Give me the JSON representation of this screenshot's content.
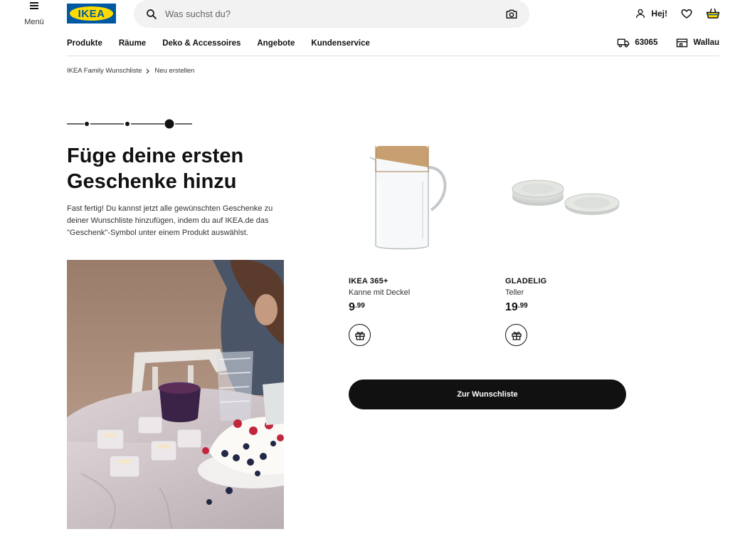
{
  "header": {
    "menu_label": "Menü",
    "logo_text": "IKEA",
    "search_placeholder": "Was suchst du?",
    "greeting": "Hej!"
  },
  "nav": {
    "items": [
      "Produkte",
      "Räume",
      "Deko & Accessoires",
      "Angebote",
      "Kundenservice"
    ],
    "postcode": "63065",
    "store": "Wallau"
  },
  "breadcrumb": {
    "parent": "IKEA Family Wunschliste",
    "current": "Neu erstellen"
  },
  "stepper": {
    "steps": 3,
    "active_step": 3
  },
  "main": {
    "title": "Füge deine ersten Geschenke hinzu",
    "description": "Fast fertig! Du kannst jetzt alle gewünschten Geschenke zu deiner Wunschliste hinzufügen, indem du auf IKEA.de das \"Geschenk\"-Symbol unter einem Produkt auswählst."
  },
  "products": [
    {
      "name": "IKEA 365+",
      "description": "Kanne mit Deckel",
      "price_int": "9",
      "price_dec": ".99",
      "icon": "gift-icon"
    },
    {
      "name": "GLADELIG",
      "description": "Teller",
      "price_int": "19",
      "price_dec": ".99",
      "icon": "gift-icon"
    }
  ],
  "cta_label": "Zur Wunschliste",
  "colors": {
    "ikea_blue": "#0058a3",
    "ikea_yellow": "#ffdb00",
    "cta_bg": "#111111"
  }
}
